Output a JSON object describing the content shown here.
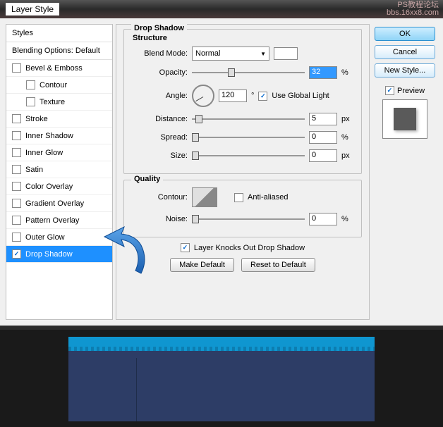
{
  "window": {
    "title": "Layer Style"
  },
  "watermark": {
    "line1": "PS教程论坛",
    "line2": "bbs.16xx8.com"
  },
  "styles": {
    "header": "Styles",
    "blending": "Blending Options: Default",
    "items": [
      {
        "label": "Bevel & Emboss",
        "checked": false
      },
      {
        "label": "Contour",
        "checked": false,
        "indent": true
      },
      {
        "label": "Texture",
        "checked": false,
        "indent": true
      },
      {
        "label": "Stroke",
        "checked": false
      },
      {
        "label": "Inner Shadow",
        "checked": false
      },
      {
        "label": "Inner Glow",
        "checked": false
      },
      {
        "label": "Satin",
        "checked": false
      },
      {
        "label": "Color Overlay",
        "checked": false
      },
      {
        "label": "Gradient Overlay",
        "checked": false
      },
      {
        "label": "Pattern Overlay",
        "checked": false
      },
      {
        "label": "Outer Glow",
        "checked": false
      },
      {
        "label": "Drop Shadow",
        "checked": true,
        "selected": true
      }
    ]
  },
  "dropShadow": {
    "title": "Drop Shadow",
    "structure": {
      "title": "Structure",
      "blendModeLabel": "Blend Mode:",
      "blendModeValue": "Normal",
      "opacityLabel": "Opacity:",
      "opacityValue": "32",
      "opacityUnit": "%",
      "angleLabel": "Angle:",
      "angleValue": "120",
      "angleUnit": "°",
      "useGlobal": "Use Global Light",
      "distanceLabel": "Distance:",
      "distanceValue": "5",
      "distanceUnit": "px",
      "spreadLabel": "Spread:",
      "spreadValue": "0",
      "spreadUnit": "%",
      "sizeLabel": "Size:",
      "sizeValue": "0",
      "sizeUnit": "px"
    },
    "quality": {
      "title": "Quality",
      "contourLabel": "Contour:",
      "antiAliased": "Anti-aliased",
      "noiseLabel": "Noise:",
      "noiseValue": "0",
      "noiseUnit": "%"
    },
    "knockout": "Layer Knocks Out Drop Shadow",
    "makeDefault": "Make Default",
    "resetDefault": "Reset to Default"
  },
  "buttons": {
    "ok": "OK",
    "cancel": "Cancel",
    "newStyle": "New Style...",
    "preview": "Preview"
  }
}
